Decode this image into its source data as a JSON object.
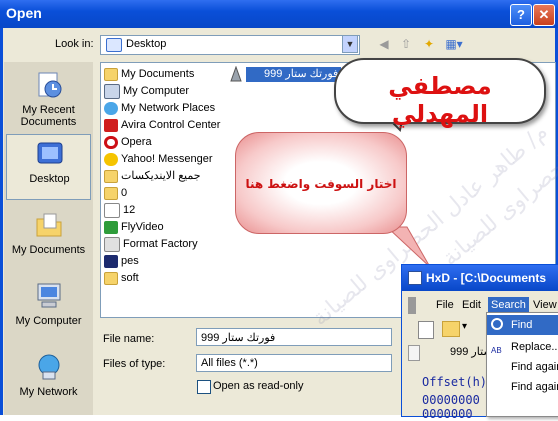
{
  "dialog": {
    "title": "Open",
    "help_btn": "?",
    "close_btn": "✕",
    "look_in_label": "Look in:",
    "look_in_value": "Desktop"
  },
  "places": [
    {
      "label": "My Recent Documents",
      "icon": "recent-documents-icon"
    },
    {
      "label": "Desktop",
      "icon": "desktop-icon"
    },
    {
      "label": "My Documents",
      "icon": "my-documents-icon"
    },
    {
      "label": "My Computer",
      "icon": "my-computer-icon"
    },
    {
      "label": "My Network",
      "icon": "my-network-icon"
    }
  ],
  "files": [
    {
      "name": "My Documents",
      "icon": "folder-icon"
    },
    {
      "name": "My Computer",
      "icon": "computer-icon"
    },
    {
      "name": "My Network Places",
      "icon": "network-icon"
    },
    {
      "name": "Avira Control Center",
      "icon": "avira-icon"
    },
    {
      "name": "Opera",
      "icon": "opera-icon"
    },
    {
      "name": "Yahoo! Messenger",
      "icon": "yahoo-icon"
    },
    {
      "name": "جميع الاينديكسات",
      "icon": "folder-icon"
    },
    {
      "name": "0",
      "icon": "folder-icon"
    },
    {
      "name": "12",
      "icon": "file-icon"
    },
    {
      "name": "FlyVideo",
      "icon": "flyvideo-icon"
    },
    {
      "name": "Format Factory",
      "icon": "format-factory-icon"
    },
    {
      "name": "pes",
      "icon": "pes-icon"
    },
    {
      "name": "soft",
      "icon": "folder-icon"
    }
  ],
  "selected_file": "فورتك ستار 999",
  "file_name_label": "File name:",
  "file_name_value": "فورتك ستار 999",
  "files_of_type_label": "Files of type:",
  "files_of_type_value": "All files (*.*)",
  "read_only_label": "Open as read-only",
  "callout_name": "مصطفي المهدلي",
  "callout_instruction": "اختار السوفت واضغط هنا",
  "watermark": "م/ طاهر عادل الحصراوى للصيانة",
  "hxd": {
    "title": "HxD - [C:\\Documents",
    "menu": [
      "File",
      "Edit",
      "Search",
      "View"
    ],
    "search_menu": [
      "Find",
      "Replace...",
      "Find again",
      "Find again"
    ],
    "tab_text": "ستار 999",
    "offset_label": "Offset(h)",
    "offset_row": "00000000",
    "address_row": "0000000"
  },
  "colors": {
    "accent": "#0a4fd8",
    "selection": "#316ac5",
    "callout_red": "#d11111"
  }
}
